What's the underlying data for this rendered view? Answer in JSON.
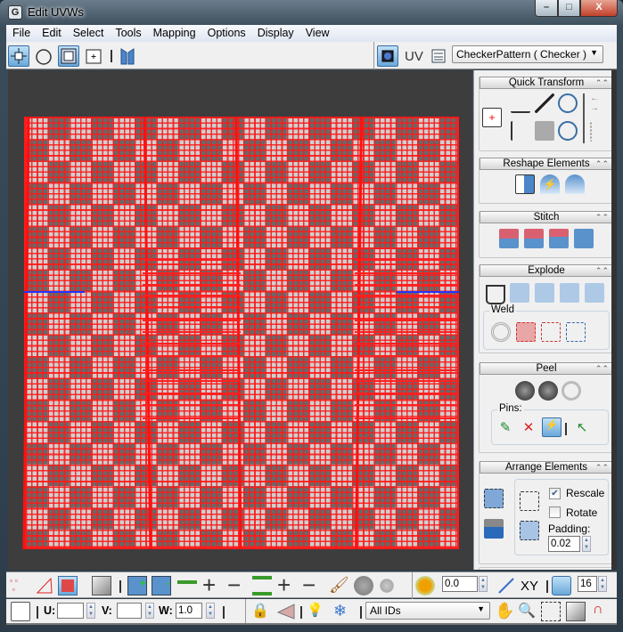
{
  "window": {
    "title": "Edit UVWs",
    "app_icon": "3ds-max-icon",
    "controls": {
      "minimize": "–",
      "maximize": "□",
      "close": "X"
    }
  },
  "menu": [
    "File",
    "Edit",
    "Select",
    "Tools",
    "Mapping",
    "Options",
    "Display",
    "View"
  ],
  "toolbar": {
    "tools": [
      "move-icon",
      "rotate-icon",
      "scale-icon",
      "freeform-icon",
      "mirror-icon"
    ],
    "uv_label": "UV",
    "texture_dropdown": "CheckerPattern  ( Checker )"
  },
  "panel": {
    "rollouts": [
      {
        "title": "Quick Transform"
      },
      {
        "title": "Reshape Elements"
      },
      {
        "title": "Stitch"
      },
      {
        "title": "Explode",
        "weld_label": "Weld"
      },
      {
        "title": "Peel",
        "pins_label": "Pins:"
      },
      {
        "title": "Arrange Elements",
        "rescale_label": "Rescale",
        "rescale_checked": true,
        "rotate_label": "Rotate",
        "rotate_checked": false,
        "padding_label": "Padding:",
        "padding_value": "0.02"
      }
    ]
  },
  "bottom": {
    "soft_select_value": "0.0",
    "xy_label": "XY",
    "grid_value": "16",
    "u_label": "U:",
    "u_value": "",
    "v_label": "V:",
    "v_value": "",
    "w_label": "W:",
    "w_value": "1.0",
    "id_filter": "All IDs"
  },
  "colors": {
    "uv_edges": "#ff1a1a",
    "viewport_bg": "#3d3d3d",
    "checker_dark": "#686868",
    "checker_light": "#cfcfcf",
    "selected_edge": "#2233ff"
  }
}
